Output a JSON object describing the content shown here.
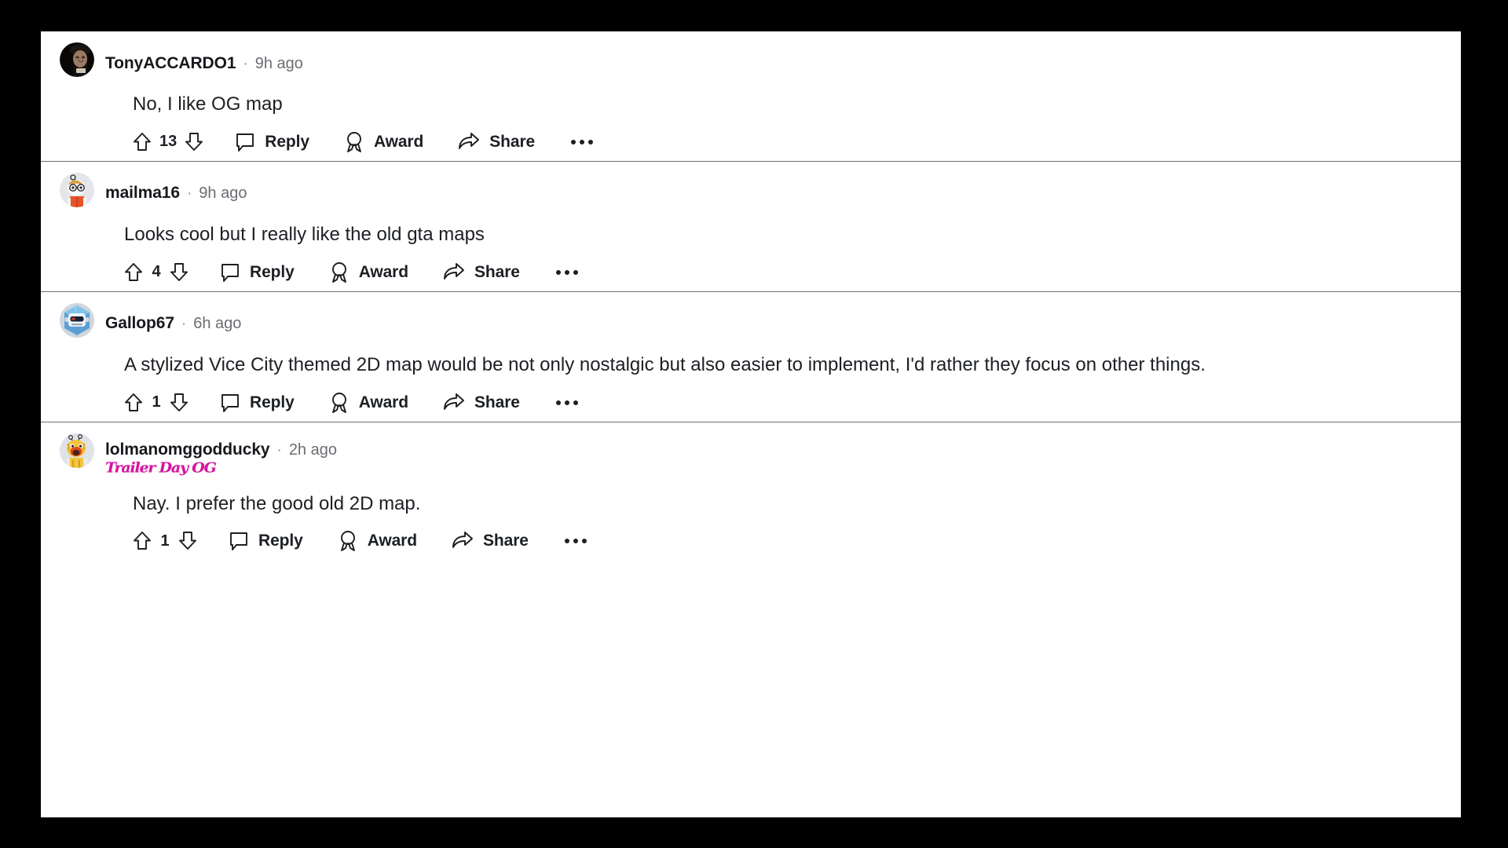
{
  "app": {
    "platform": "reddit-comments",
    "background_color": "#000000",
    "panel_color": "#ffffff",
    "text_color": "#1c1f23",
    "muted_text_color": "#6a6d71",
    "divider_color": "#6b6e72",
    "flair_color": "#d615a0"
  },
  "action_labels": {
    "reply": "Reply",
    "award": "Award",
    "share": "Share",
    "more": "More options"
  },
  "separator": "·",
  "comments": [
    {
      "username": "TonyACCARDO1",
      "timestamp": "9h ago",
      "flair": "",
      "body": "No, I like OG map",
      "votes": "13",
      "avatar": "bearded-man-photo-avatar"
    },
    {
      "username": "mailma16",
      "timestamp": "9h ago",
      "flair": "",
      "body": "Looks cool but I really like the old gta maps",
      "votes": "4",
      "avatar": "snoo-blonde-glasses-orange-shirt-avatar"
    },
    {
      "username": "Gallop67",
      "timestamp": "6h ago",
      "flair": "",
      "body": "A stylized Vice City themed 2D map would be not only nostalgic but also easier to implement, I'd rather they focus on other things.",
      "votes": "1",
      "avatar": "blue-robot-avatar"
    },
    {
      "username": "lolmanomggodducky",
      "timestamp": "2h ago",
      "flair": "Trailer Day OG",
      "body": "Nay. I prefer the good old 2D map.",
      "votes": "1",
      "avatar": "yellow-tiger-snoo-avatar"
    }
  ]
}
